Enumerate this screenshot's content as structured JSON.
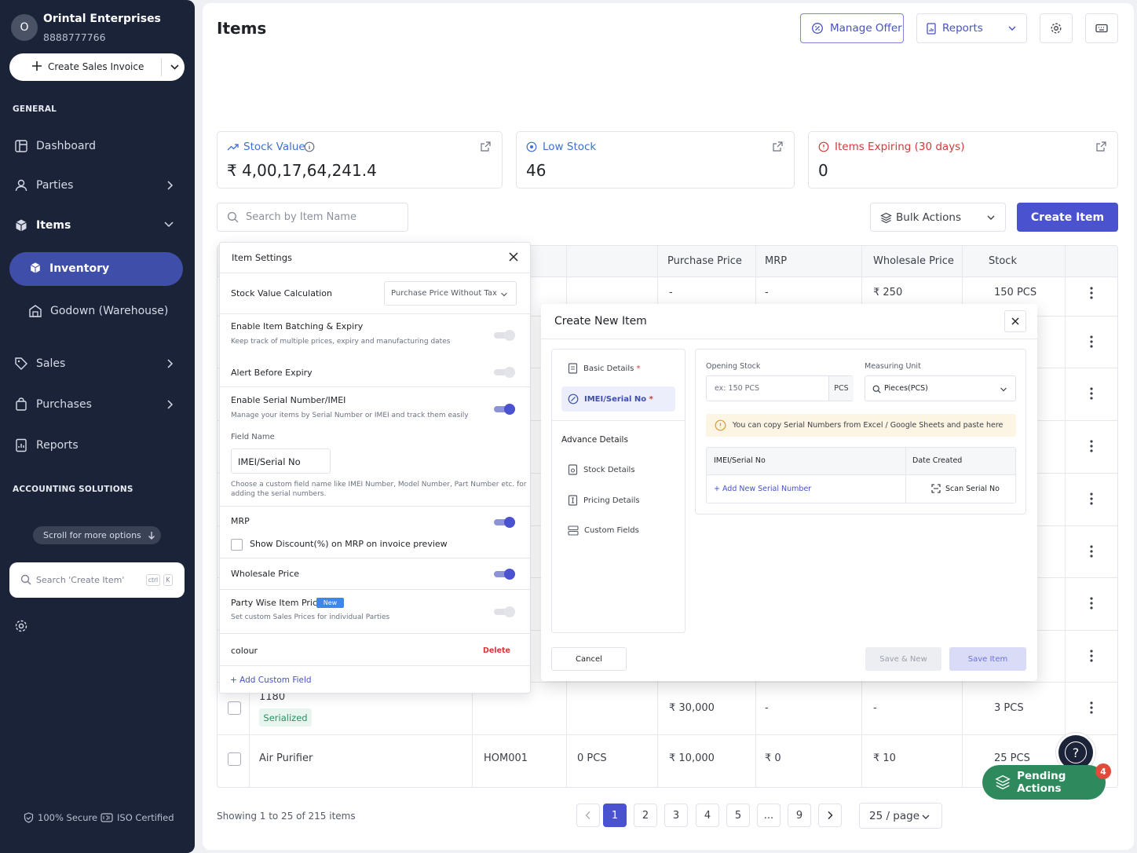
{
  "sidebar": {
    "avatar_letter": "O",
    "business_name": "Orintal Enterprises",
    "phone": "8888777766",
    "create_button": "Create Sales Invoice",
    "section_general": "GENERAL",
    "nav": {
      "dashboard": "Dashboard",
      "parties": "Parties",
      "items": "Items",
      "inventory": "Inventory",
      "godown": "Godown (Warehouse)",
      "sales": "Sales",
      "purchases": "Purchases",
      "reports": "Reports"
    },
    "section_accounting": "ACCOUNTING SOLUTIONS",
    "scroll_hint": "Scroll for more options",
    "search_placeholder": "Search 'Create Item'",
    "shortcut_ctrl": "ctrl",
    "shortcut_k": "K",
    "settings": "Settings",
    "secure": "100% Secure",
    "iso": "ISO Certified"
  },
  "header": {
    "title": "Items",
    "manage_offer": "Manage Offer",
    "reports": "Reports"
  },
  "stats": {
    "stock_value_label": "Stock Value",
    "stock_value": "₹  4,00,17,64,241.4",
    "low_stock_label": "Low Stock",
    "low_stock": "46",
    "expiring_label": "Items Expiring (30 days)",
    "expiring": "0"
  },
  "toolbar": {
    "search_placeholder": "Search by Item Name",
    "bulk_actions": "Bulk Actions",
    "create_item": "Create Item"
  },
  "table": {
    "columns": {
      "purchase_price": "Purchase Price",
      "mrp": "MRP",
      "wholesale_price": "Wholesale Price",
      "stock": "Stock"
    },
    "row_first": {
      "purchase_price": "-",
      "mrp": "-",
      "wholesale_price": "₹ 250",
      "stock": "150 PCS"
    },
    "row_1180": {
      "name": "1180",
      "badge": "Serialized",
      "purchase_price": "₹ 30,000",
      "mrp": "-",
      "wholesale_price": "-",
      "stock": "3 PCS"
    },
    "row_air": {
      "name": "Air Purifier",
      "code": "HOM001",
      "opening": "0 PCS",
      "purchase_price": "₹ 10,000",
      "mrp": "₹ 0",
      "wholesale_price": "₹ 10",
      "stock": "25 PCS"
    }
  },
  "pagination": {
    "showing": "Showing 1 to 25 of 215 items",
    "pages": [
      "1",
      "2",
      "3",
      "4",
      "5",
      "...",
      "9"
    ],
    "per_page": "25 / page"
  },
  "item_settings": {
    "title": "Item Settings",
    "stock_calc_label": "Stock Value Calculation",
    "stock_calc_value": "Purchase Price Without Tax",
    "batching_label": "Enable Item Batching & Expiry",
    "batching_desc": "Keep track of multiple prices, expiry and manufacturing dates",
    "batching_on": false,
    "alert_label": "Alert Before Expiry",
    "alert_on": false,
    "serial_label": "Enable Serial Number/IMEI",
    "serial_desc": "Manage your items by Serial Number or IMEI and track them easily",
    "serial_on": true,
    "field_name_label": "Field Name",
    "field_name_value": "IMEI/Serial No",
    "field_hint_1": "Choose a custom field name like IMEI Number, Model Number, Part Number etc. for",
    "field_hint_2": "adding the serial numbers.",
    "mrp_label": "MRP",
    "mrp_on": true,
    "show_discount": "Show Discount(%) on MRP on invoice preview",
    "wholesale_label": "Wholesale Price",
    "wholesale_on": true,
    "party_label": "Party Wise Item Price",
    "party_badge": "New",
    "party_desc": "Set custom Sales Prices for individual Parties",
    "party_on": false,
    "custom_field": "colour",
    "delete": "Delete",
    "add_custom": "+ Add Custom Field"
  },
  "create_item_dialog": {
    "title": "Create New Item",
    "nav_basic": "Basic Details",
    "nav_imei": "IMEI/Serial No",
    "req_mark": "*",
    "advance": "Advance Details",
    "nav_stock": "Stock Details",
    "nav_pricing": "Pricing Details",
    "nav_custom": "Custom Fields",
    "opening_label": "Opening Stock",
    "opening_placeholder": "ex: 150 PCS",
    "opening_unit": "PCS",
    "unit_label": "Measuring Unit",
    "unit_value": "Pieces(PCS)",
    "tip": "You can copy Serial Numbers from Excel / Google Sheets and paste here",
    "col_imei": "IMEI/Serial No",
    "col_date": "Date Created",
    "add_serial": "+ Add New Serial Number",
    "scan": "Scan Serial No",
    "cancel": "Cancel",
    "save_new": "Save & New",
    "save": "Save Item"
  },
  "floating": {
    "help": "?",
    "pending": "Pending Actions",
    "pending_count": "4"
  },
  "colors": {
    "sidebar_bg": "#1b2339",
    "accent": "#4a52cf",
    "success": "#2e8a5c",
    "danger": "#d03b3b"
  }
}
